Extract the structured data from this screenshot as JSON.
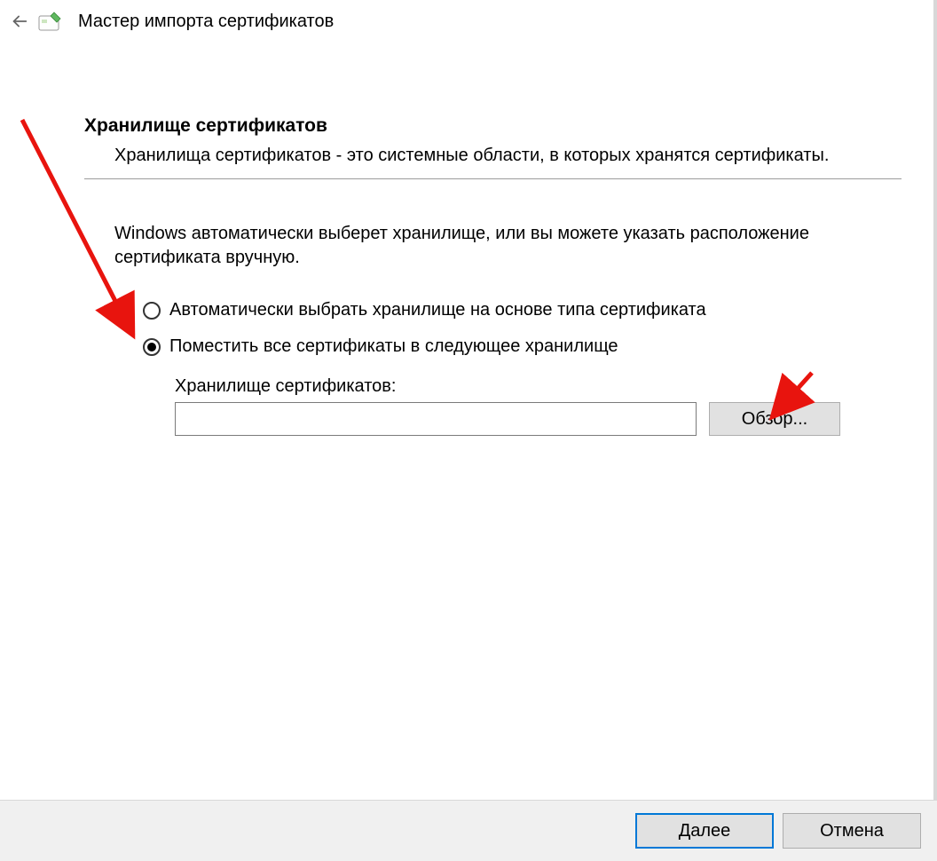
{
  "header": {
    "title": "Мастер импорта сертификатов"
  },
  "section": {
    "heading": "Хранилище сертификатов",
    "description": "Хранилища сертификатов - это системные области, в которых хранятся сертификаты."
  },
  "instruction": "Windows автоматически выберет хранилище, или вы можете указать расположение сертификата вручную.",
  "radios": {
    "auto": {
      "label": "Автоматически выбрать хранилище на основе типа сертификата",
      "selected": false
    },
    "manual": {
      "label": "Поместить все сертификаты в следующее хранилище",
      "selected": true
    }
  },
  "store": {
    "label": "Хранилище сертификатов:",
    "value": "",
    "browse_label": "Обзор..."
  },
  "footer": {
    "next_label": "Далее",
    "cancel_label": "Отмена"
  }
}
